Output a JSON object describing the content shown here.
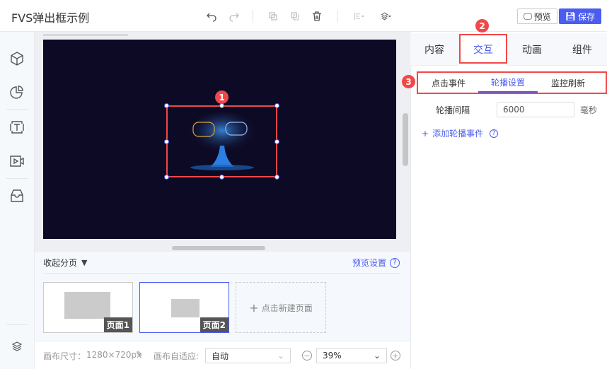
{
  "header": {
    "title": "FVS弹出框示例",
    "preview_label": "预览",
    "save_label": "保存"
  },
  "toolbar": [
    "undo-icon",
    "redo-icon",
    "copy-icon",
    "paste-icon",
    "delete-icon",
    "align-icon",
    "layer-order-icon"
  ],
  "sidebar": {
    "items": [
      "component-icon",
      "chart-icon",
      "text-icon",
      "video-icon",
      "inbox-icon"
    ],
    "bottom": "layers-icon"
  },
  "canvas": {
    "background": "#0d0a25",
    "badge": "1"
  },
  "pages": {
    "collapse_label": "收起分页",
    "preview_settings": "预览设置",
    "items": [
      {
        "label": "页面1",
        "selected": false
      },
      {
        "label": "页面2",
        "selected": true
      }
    ],
    "new_page": "点击新建页面"
  },
  "bottom": {
    "size_label": "画布尺寸：",
    "size_value": "1280×720px",
    "fit_label": "画布自适应:",
    "fit_value": "自动",
    "zoom_value": "39%"
  },
  "right": {
    "tabs": [
      "内容",
      "交互",
      "动画",
      "组件"
    ],
    "active_tab": "交互",
    "tab_badge": "2",
    "subtabs": [
      "点击事件",
      "轮播设置",
      "监控刷新"
    ],
    "active_subtab": "轮播设置",
    "subtab_badge": "3",
    "interval_label": "轮播间隔",
    "interval_value": "6000",
    "interval_unit": "毫秒",
    "add_event": "添加轮播事件"
  },
  "colors": {
    "accent": "#4b5cf0",
    "highlight": "#f04848"
  }
}
